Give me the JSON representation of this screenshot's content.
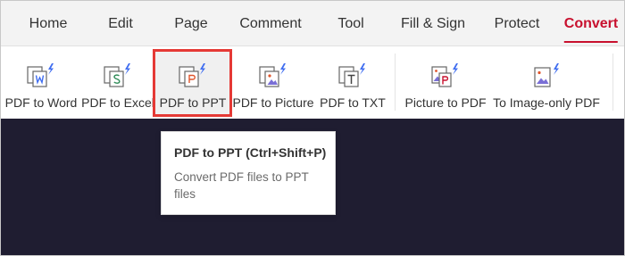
{
  "menu": {
    "items": [
      {
        "label": "Home"
      },
      {
        "label": "Edit"
      },
      {
        "label": "Page"
      },
      {
        "label": "Comment"
      },
      {
        "label": "Tool"
      },
      {
        "label": "Fill & Sign"
      },
      {
        "label": "Protect"
      },
      {
        "label": "Convert",
        "active": true
      }
    ]
  },
  "ribbon": {
    "tools": [
      {
        "label": "PDF to Word",
        "icon": "pdf-to-word-icon",
        "letter": "W"
      },
      {
        "label": "PDF to Excel",
        "icon": "pdf-to-excel-icon",
        "letter": "S"
      },
      {
        "label": "PDF to PPT",
        "icon": "pdf-to-ppt-icon",
        "letter": "P",
        "highlighted": true
      },
      {
        "label": "PDF to Picture",
        "icon": "pdf-to-picture-icon"
      },
      {
        "label": "PDF to TXT",
        "icon": "pdf-to-txt-icon",
        "letter": "T"
      },
      {
        "label": "Picture to PDF",
        "icon": "picture-to-pdf-icon"
      },
      {
        "label": "To Image-only PDF",
        "icon": "to-image-only-pdf-icon"
      }
    ]
  },
  "tooltip": {
    "title": "PDF to PPT (Ctrl+Shift+P)",
    "description": "Convert PDF files to PPT files"
  },
  "colors": {
    "accent": "#c8102e",
    "highlight_border": "#e53935",
    "sparkle": "#3f6df0",
    "content_bg": "#1f1d31",
    "menubar_bg": "#f3f3f3"
  }
}
